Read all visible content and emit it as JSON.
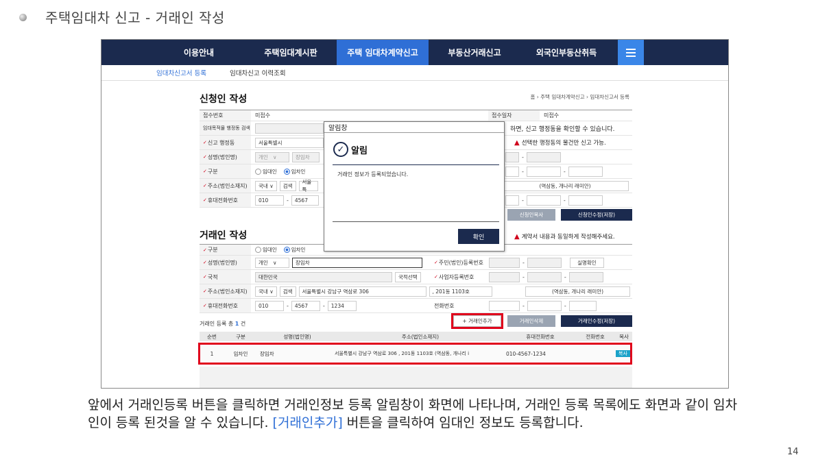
{
  "slide": {
    "title": "주택임대차 신고 - 거래인 작성",
    "page_number": "14",
    "description_before": "앞에서 거래인등록 버튼을 클릭하면 거래인정보 등록 알림창이 화면에 나타나며, 거래인 등록 목록에도 화면과 같이 임차인이 등록 된것을 알 수 있습니다. ",
    "description_highlight": "[거래인추가]",
    "description_after": " 버튼을 클릭하여 임대인 정보도 등록합니다."
  },
  "nav": {
    "items": [
      "이용안내",
      "주택임대계시판",
      "주택 임대차계약신고",
      "부동산거래신고",
      "외국인부동산취득"
    ]
  },
  "subnav": {
    "items": [
      "임대차신고서 등록",
      "임대차신고 이력조회"
    ]
  },
  "applicant": {
    "title": "신청인 작성",
    "breadcrumb": "홈 ›  주택 임대차계약신고 ›   임대차신고서 등록",
    "receipt_no_label": "접수번호",
    "receipt_no": "미접수",
    "receipt_date_label": "접수일자",
    "receipt_date": "미접수",
    "dong_search_label": "임대목적물 행정동 검색",
    "dong_search_note": "하면, 신고 행정동을 확인할 수 있습니다.",
    "report_dong_label": "신고 행정동",
    "report_dong": "서울특별시",
    "report_dong_warn": "선택한 행정동의 물건만 신고 가능.",
    "name_label": "성명(법인명)",
    "name_type": "개인",
    "name": "장임차",
    "type_label": "구분",
    "type_opt1": "임대인",
    "type_opt2": "임차인",
    "addr_label": "주소(법인소재지)",
    "addr_domestic": "국내",
    "addr_search": "검색",
    "addr_partial": "서울특",
    "addr_extra": "(역삼동, 개나리 래미안)",
    "phone_label": "휴대전화번호",
    "phone1": "010",
    "phone2": "4567",
    "btn_copy": "신청인복사",
    "btn_save": "신청인수정(저장)"
  },
  "party": {
    "title": "거래인 작성",
    "warn": "계약서 내용과 동일하게 작성해주세요.",
    "type_label": "구분",
    "type_opt1": "임대인",
    "type_opt2": "임차인",
    "name_label": "성명(법인명)",
    "name_type": "개인",
    "name": "장임차",
    "rrn_label": "주민(법인)등록번호",
    "verify_btn": "실명확인",
    "nation_label": "국적",
    "nation": "대한민국",
    "nation_btn": "국적선택",
    "biz_label": "사업자등록번호",
    "addr_label": "주소(법인소재지)",
    "addr_domestic": "국내",
    "addr_search": "검색",
    "addr": "서울특별시 강남구 역삼로 306",
    "addr_detail": ", 201동 1103호",
    "addr_extra": "(역삼동, 개나리 래미안)",
    "phone_label": "휴대전화번호",
    "phone1": "010",
    "phone2": "4567",
    "phone3": "1234",
    "tel_label": "전화번호",
    "count_prefix": "거래인 등록 총 ",
    "count": "1",
    "count_suffix": " 건",
    "btn_add": "+ 거래인추가",
    "btn_delete": "거래인삭제",
    "btn_save": "거래인수정(저장)"
  },
  "table": {
    "headers": [
      "순번",
      "구분",
      "성명(법인명)",
      "주소(법인소재지)",
      "휴대전화번호",
      "전화번호",
      "복사"
    ],
    "row": {
      "no": "1",
      "type": "임차인",
      "name": "장임차",
      "addr": "서울특별시 강남구 역삼로 306 , 201동 1103호 (역삼동, 개나리 i",
      "phone": "010-4567-1234",
      "copy": "복사"
    }
  },
  "dialog": {
    "window_title": "알림창",
    "heading": "알림",
    "message": "거래인 정보가 등록되었습니다.",
    "ok": "확인"
  }
}
